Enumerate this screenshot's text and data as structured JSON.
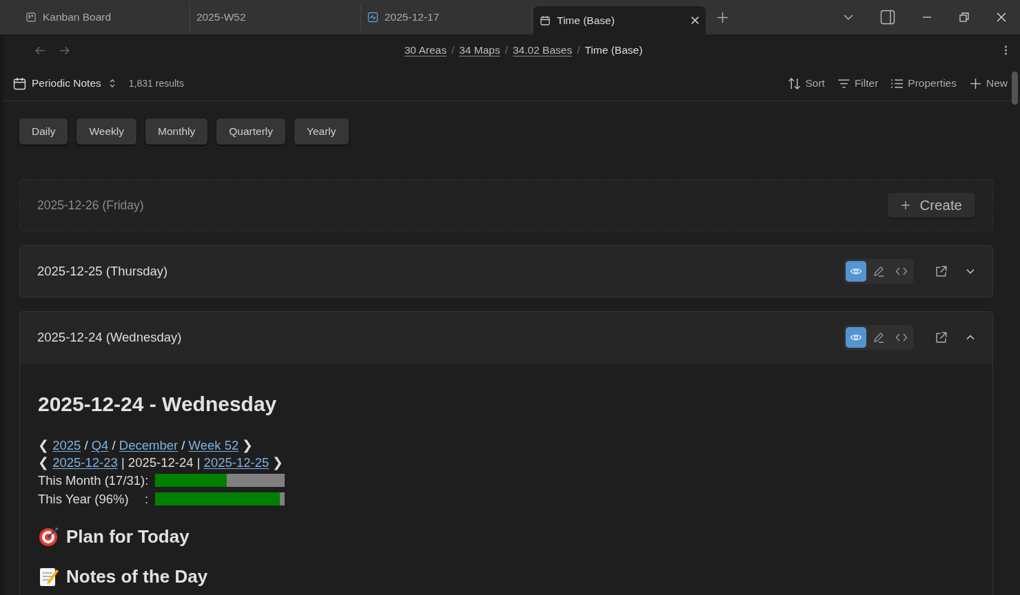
{
  "tabs": [
    {
      "label": "Kanban Board",
      "kind": "kanban",
      "selected": false
    },
    {
      "label": "2025-W52",
      "kind": "plain",
      "selected": false
    },
    {
      "label": "2025-12-17",
      "kind": "activity",
      "selected": false
    },
    {
      "label": "Time (Base)",
      "kind": "base",
      "selected": true
    }
  ],
  "breadcrumb": [
    {
      "text": "30 Areas",
      "kind": "link"
    },
    {
      "text": "/",
      "kind": "separator"
    },
    {
      "text": "34 Maps",
      "kind": "link"
    },
    {
      "text": "/",
      "kind": "separator"
    },
    {
      "text": "34.02 Bases",
      "kind": "link"
    },
    {
      "text": "/",
      "kind": "separator"
    },
    {
      "text": "Time (Base)",
      "kind": "current"
    }
  ],
  "toolbar": {
    "view": "Periodic Notes",
    "count": "1,831 results",
    "actions": [
      {
        "label": "Sort",
        "kind": "sort"
      },
      {
        "label": "Filter",
        "kind": "filter"
      },
      {
        "label": "Properties",
        "kind": "properties"
      },
      {
        "label": "New",
        "kind": "new"
      }
    ]
  },
  "filters": [
    "Daily",
    "Weekly",
    "Monthly",
    "Quarterly",
    "Yearly"
  ],
  "notes": [
    {
      "kind": "empty",
      "title": "2025-12-26 (Friday)",
      "action": "Create"
    },
    {
      "kind": "note",
      "title": "2025-12-25 (Thursday)",
      "expanded": false,
      "modes": [
        {
          "selected": true
        },
        {
          "selected": false
        },
        {
          "selected": false
        }
      ]
    },
    {
      "kind": "note",
      "title": "2025-12-24 (Wednesday)",
      "expanded": true,
      "modes": [
        {
          "selected": true
        },
        {
          "selected": false
        },
        {
          "selected": false
        }
      ]
    }
  ],
  "content": {
    "heading": "2025-12-24 - Wednesday",
    "nav_lines": [
      [
        {
          "text": "❮",
          "link": false
        },
        {
          "text": "2025",
          "link": true
        },
        {
          "text": "/",
          "link": false
        },
        {
          "text": "Q4",
          "link": true
        },
        {
          "text": "/",
          "link": false
        },
        {
          "text": "December",
          "link": true
        },
        {
          "text": "/",
          "link": false
        },
        {
          "text": "Week 52",
          "link": true
        },
        {
          "text": "❯",
          "link": false
        }
      ],
      [
        {
          "text": "❮",
          "link": false
        },
        {
          "text": "2025-12-23",
          "link": true
        },
        {
          "text": "| 2025-12-24 |",
          "link": false
        },
        {
          "text": "2025-12-25",
          "link": true
        },
        {
          "text": "❯",
          "link": false
        }
      ]
    ],
    "progress": [
      {
        "label": "This Month (17/31)",
        "sep": ":",
        "level": 0.55
      },
      {
        "label": "This Year (96%)",
        "sep": ":",
        "level": 0.96
      }
    ],
    "sections": [
      {
        "kind": "target",
        "title": "Plan for Today"
      },
      {
        "kind": "memo",
        "title": "Notes of the Day"
      }
    ]
  }
}
